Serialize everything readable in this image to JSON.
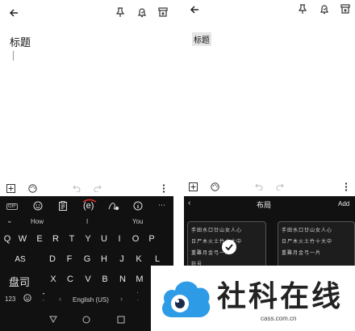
{
  "left_note": {
    "title": "标题"
  },
  "right_note": {
    "title": "标题"
  },
  "keyboard": {
    "suggestions": [
      "How",
      "I",
      "You"
    ],
    "row1": [
      "Q",
      "W",
      "E",
      "R",
      "T",
      "Y",
      "U",
      "I",
      "O",
      "P"
    ],
    "row2_left": "AS",
    "row2": [
      "D",
      "F",
      "G",
      "H",
      "J",
      "K",
      "L"
    ],
    "row3_left": "盘司",
    "row3": [
      "X",
      "C",
      "V",
      "B",
      "N",
      "M"
    ],
    "num_label": "123",
    "lang_label": "English (US)",
    "gif_label": "GIF",
    "center_label": "(e)"
  },
  "layout_panel": {
    "title": "布局",
    "add_label": "Add",
    "card1_rows": [
      "手田水口廿山女人心",
      "日尸木火土竹十大中",
      "重難月金弓一片",
      "符号"
    ],
    "card2_rows": [
      "手田水口廿山女人心",
      "日尸木火土竹十大中",
      "重難月金弓一片"
    ]
  },
  "logo": {
    "name": "社科在线",
    "url": "cass.com.cn"
  },
  "colors": {
    "keyboard_bg": "#111111",
    "accent_red": "#e0302a",
    "logo_blue": "#2d9be6"
  }
}
